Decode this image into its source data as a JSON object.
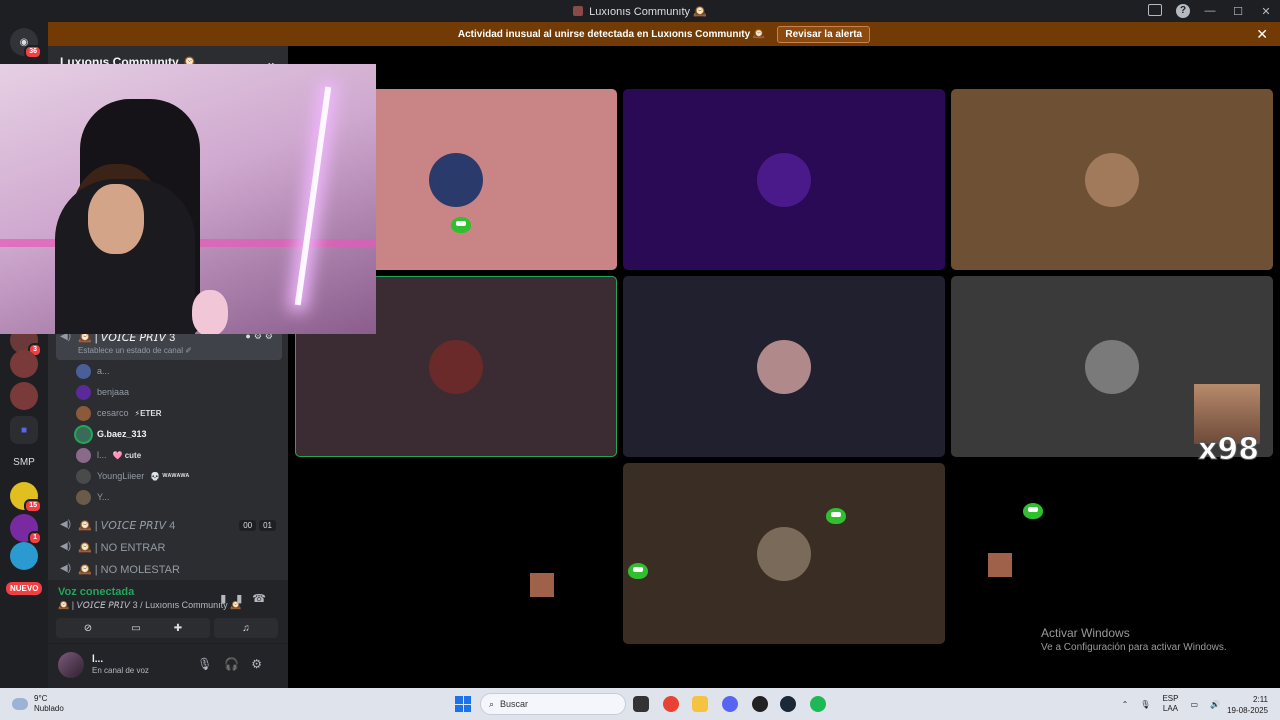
{
  "window": {
    "title": "Luxıonıs Communıty 🕰️",
    "controls": [
      "—",
      "☐",
      "✕"
    ]
  },
  "alert": {
    "message": "Actividad inusual al unirse detectada en Luxıonıs Communıty 🕰️",
    "button": "Revisar la alerta",
    "close": "✕"
  },
  "guilds": {
    "home_badge": "36",
    "badges": [
      "3",
      "15",
      "1",
      "1"
    ],
    "smp_label": "SMP",
    "nuevo_label": "NUEVO"
  },
  "sidebar": {
    "server_name": "Luxıonıs Communıty 🕰️",
    "active_channel": {
      "name": "🕰️ | 𝘝𝘖𝘐𝘊𝘌 𝘗𝘙𝘐𝘝 3",
      "status": "Establece un estado de canal ✐"
    },
    "members": [
      {
        "name": "a...",
        "tag": "",
        "color": "#4a5f9a"
      },
      {
        "name": "benjaaa",
        "tag": "",
        "color": "#5a2a9a"
      },
      {
        "name": "cesarco",
        "tag": "⚡ETER",
        "color": "#8a5a3a"
      },
      {
        "name": "G.baez_313",
        "tag": "",
        "color": "#3a6a5a"
      },
      {
        "name": "l...",
        "tag": "🩷 cute",
        "color": "#8a6a8a"
      },
      {
        "name": "YoungLiieer",
        "tag": "💀 ᵂᴬᵂᴬᵂᴬ",
        "color": "#4a4a4a"
      },
      {
        "name": "Y...",
        "tag": "",
        "color": "#6a5a4a"
      }
    ],
    "channels": [
      {
        "name": "🕰️ | 𝘝𝘖𝘐𝘊𝘌 𝘗𝘙𝘐𝘝 4",
        "counts": [
          "00",
          "01"
        ]
      },
      {
        "name": "🕰️ | NO ENTRAR",
        "counts": []
      },
      {
        "name": "🕰️ | NO MOLESTAR",
        "counts": []
      }
    ]
  },
  "voice": {
    "connected": "Voz conectada",
    "location": "🕰️ | 𝘝𝘖𝘐𝘊𝘌 𝘗𝘙𝘐𝘝 3 / Luxıonıs Communıty 🕰️"
  },
  "user": {
    "name": "l...",
    "status": "En canal de voz"
  },
  "tiles": [
    {
      "bg": "#c98585",
      "avatar": "#2a3a6a"
    },
    {
      "bg": "#2b0a55",
      "avatar": "#4a1a8a"
    },
    {
      "bg": "#6e5034",
      "avatar": "#a07a5a"
    },
    {
      "bg": "#3b2c33",
      "avatar": "#6a2a2a",
      "active": true
    },
    {
      "bg": "#20202e",
      "avatar": "#b08a8a"
    },
    {
      "bg": "#3a3a3a",
      "avatar": "#7a7a7a"
    },
    {
      "bg": "#3a2e24",
      "avatar": "#7a6a5a"
    }
  ],
  "overlay": {
    "x98": "x98"
  },
  "watermark": {
    "line1": "Activar Windows",
    "line2": "Ve a Configuración para activar Windows."
  },
  "taskbar": {
    "temp": "9°C",
    "weather": "Nublado",
    "search_placeholder": "Buscar",
    "lang1": "ESP",
    "lang2": "LAA",
    "time": "2:11",
    "date": "19-08-2025"
  }
}
